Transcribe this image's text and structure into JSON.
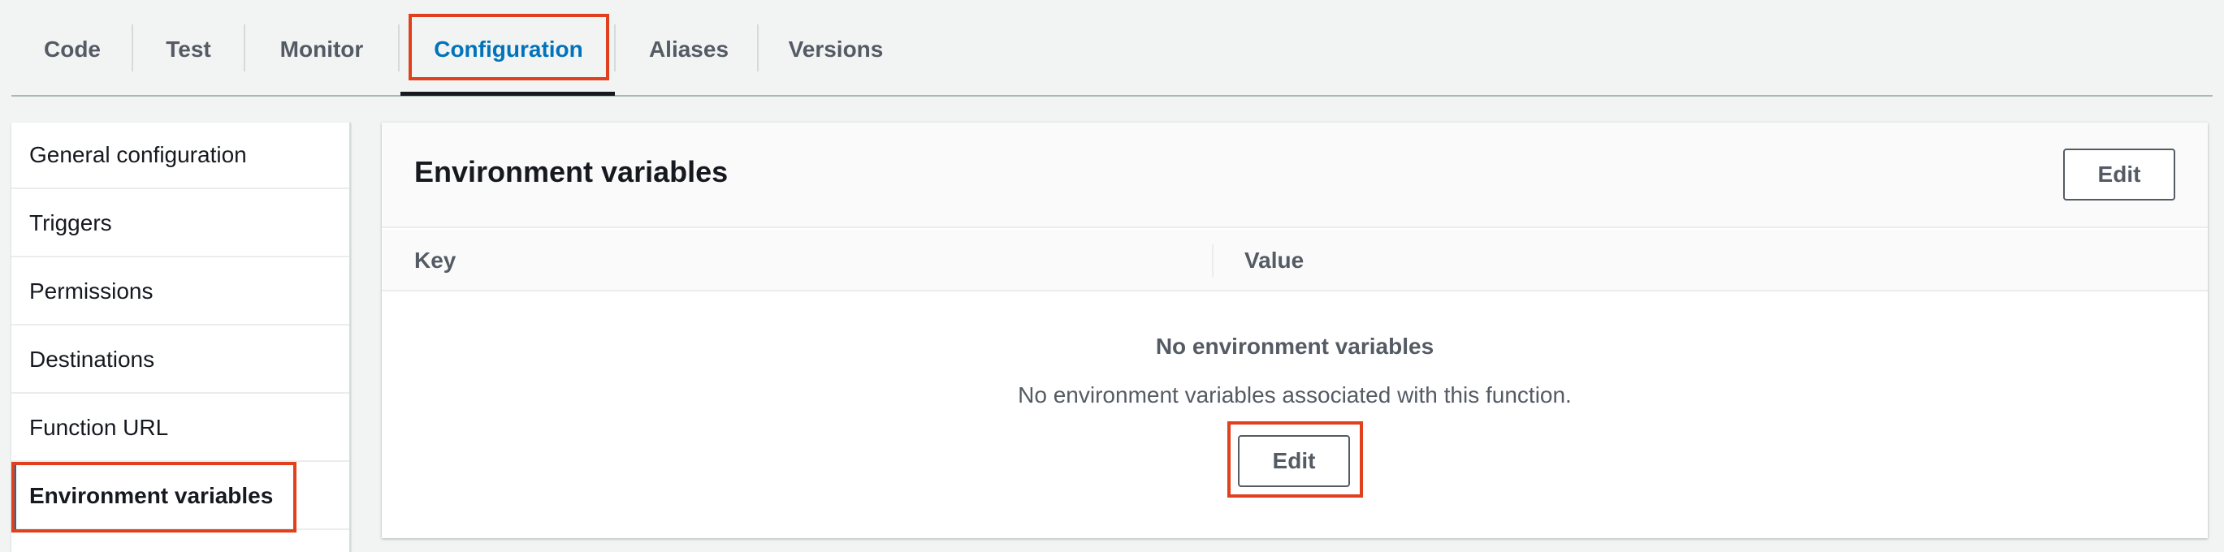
{
  "tabs": [
    {
      "label": "Code"
    },
    {
      "label": "Test"
    },
    {
      "label": "Monitor"
    },
    {
      "label": "Configuration"
    },
    {
      "label": "Aliases"
    },
    {
      "label": "Versions"
    }
  ],
  "active_tab": "Configuration",
  "sidebar": {
    "items": [
      {
        "label": "General configuration"
      },
      {
        "label": "Triggers"
      },
      {
        "label": "Permissions"
      },
      {
        "label": "Destinations"
      },
      {
        "label": "Function URL"
      },
      {
        "label": "Environment variables"
      }
    ],
    "active_item": "Environment variables"
  },
  "panel": {
    "title": "Environment variables",
    "edit_label": "Edit",
    "columns": [
      "Key",
      "Value"
    ],
    "empty": {
      "title": "No environment variables",
      "description": "No environment variables associated with this function.",
      "edit_label": "Edit"
    }
  },
  "colors": {
    "accent": "#0073bb",
    "highlight": "#e0401c",
    "text": "#16191f",
    "muted": "#545b64"
  }
}
